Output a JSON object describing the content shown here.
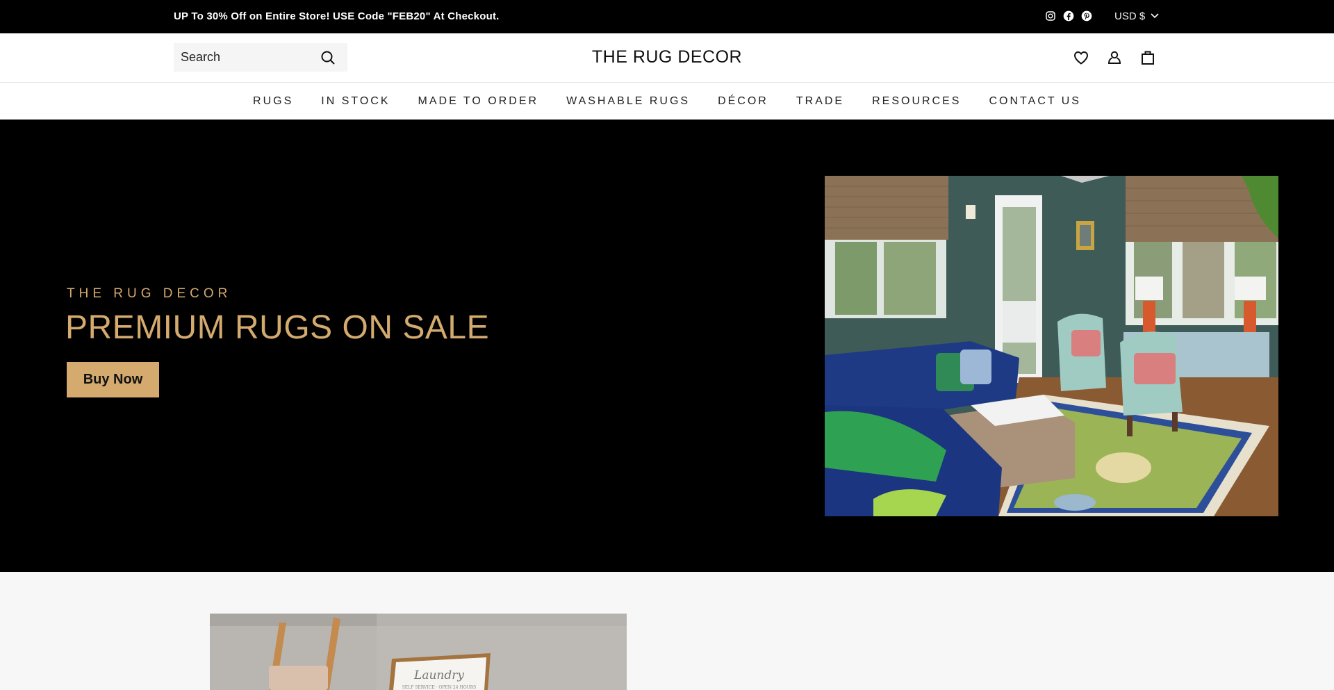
{
  "announcement": {
    "text": "UP To 30% Off on Entire Store! USE Code \"FEB20\" At Checkout.",
    "social": [
      {
        "name": "instagram-icon"
      },
      {
        "name": "facebook-icon"
      },
      {
        "name": "pinterest-icon"
      }
    ],
    "currency": "USD $"
  },
  "header": {
    "search_placeholder": "Search",
    "logo": "THE RUG DECOR",
    "icons": [
      "heart-icon",
      "account-icon",
      "cart-icon"
    ]
  },
  "nav": {
    "items": [
      "RUGS",
      "IN STOCK",
      "MADE TO ORDER",
      "WASHABLE RUGS",
      "DÉCOR",
      "TRADE",
      "RESOURCES",
      "CONTACT US"
    ]
  },
  "hero": {
    "subtitle": "THE RUG DECOR",
    "title": "PREMIUM RUGS ON SALE",
    "button": "Buy Now",
    "image_alt": "Living room with navy sofa, light blue wingback chairs, woven ottoman and green patterned rug"
  },
  "lower": {
    "image_alt": "Wooden ladder with towel and framed Laundry sign against concrete wall",
    "sign_title": "Laundry",
    "sign_sub": "SELF SERVICE · OPEN 24 HOURS"
  },
  "colors": {
    "accent_gold": "#d4aa6e",
    "bar_black": "#000000",
    "section_bg": "#f7f7f7"
  }
}
